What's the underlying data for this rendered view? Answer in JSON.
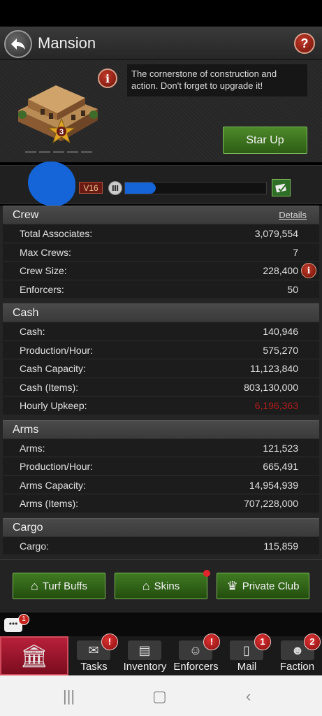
{
  "header": {
    "title": "Mansion",
    "help": "?"
  },
  "building": {
    "description": "The cornerstone of construction and action. Don't forget to upgrade it!",
    "star_level": "3",
    "info_symbol": "i",
    "star_up_label": "Star Up"
  },
  "player": {
    "vip": "V16",
    "exp_progress": 0.22
  },
  "sections": {
    "crew": {
      "title": "Crew",
      "details_label": "Details",
      "rows": [
        {
          "label": "Total Associates:",
          "value": "3,079,554"
        },
        {
          "label": "Max Crews:",
          "value": "7"
        },
        {
          "label": "Crew Size:",
          "value": "228,400"
        },
        {
          "label": "Enforcers:",
          "value": "50"
        }
      ]
    },
    "cash": {
      "title": "Cash",
      "rows": [
        {
          "label": "Cash:",
          "value": "140,946"
        },
        {
          "label": "Production/Hour:",
          "value": "575,270"
        },
        {
          "label": "Cash Capacity:",
          "value": "11,123,840"
        },
        {
          "label": "Cash (Items):",
          "value": "803,130,000"
        },
        {
          "label": "Hourly Upkeep:",
          "value": "6,196,363"
        }
      ]
    },
    "arms": {
      "title": "Arms",
      "rows": [
        {
          "label": "Arms:",
          "value": "121,523"
        },
        {
          "label": "Production/Hour:",
          "value": "665,491"
        },
        {
          "label": "Arms Capacity:",
          "value": "14,954,939"
        },
        {
          "label": "Arms (Items):",
          "value": "707,228,000"
        }
      ]
    },
    "cargo": {
      "title": "Cargo",
      "rows": [
        {
          "label": "Cargo:",
          "value": "115,859"
        }
      ]
    }
  },
  "buttons": {
    "turf_buffs": "Turf Buffs",
    "skins": "Skins",
    "private_club": "Private Club"
  },
  "chat": {
    "badge": "1"
  },
  "nav": {
    "tasks": {
      "label": "Tasks",
      "badge": "!"
    },
    "inventory": {
      "label": "Inventory"
    },
    "enforcers": {
      "label": "Enforcers",
      "badge": "!"
    },
    "mail": {
      "label": "Mail",
      "badge": "1"
    },
    "faction": {
      "label": "Faction",
      "badge": "2"
    }
  },
  "colors": {
    "accent_green": "#3f7a22",
    "upkeep_red": "#b01c1c",
    "redaction_blue": "#1565d8"
  }
}
